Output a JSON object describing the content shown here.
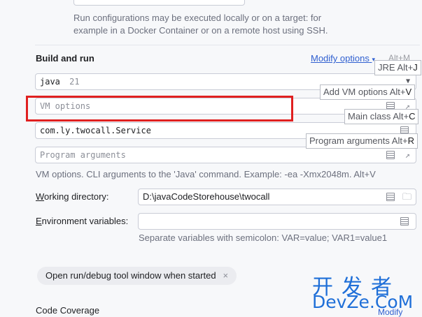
{
  "description": {
    "line1": "Run configurations may be executed locally or on a target: for",
    "line2": "example in a Docker Container or on a remote host using SSH."
  },
  "build_and_run": {
    "title": "Build and run",
    "modify_options_label": "Modify options",
    "modify_options_shortcut": "Alt+M",
    "jre": {
      "value": "java",
      "version": "21"
    },
    "vm_options": {
      "placeholder": "VM options"
    },
    "main_class": {
      "value": "com.ly.twocall.Service"
    },
    "program_arguments": {
      "placeholder": "Program arguments"
    },
    "vm_hint": "VM options. CLI arguments to the 'Java' command. Example: -ea -Xmx2048m. Alt+V"
  },
  "popups": {
    "jre": {
      "label": "JRE",
      "shortcut": "Alt+",
      "key": "J"
    },
    "vm": {
      "label": "Add VM options",
      "shortcut": "Alt+",
      "key": "V"
    },
    "main": {
      "label": "Main class",
      "shortcut": "Alt+",
      "key": "C"
    },
    "args": {
      "label": "Program arguments",
      "shortcut": "Alt+",
      "key": "R"
    }
  },
  "working_directory": {
    "label_prefix": "",
    "label_mnemonic": "W",
    "label_rest": "orking directory:",
    "value": "D:\\javaCodeStorehouse\\twocall"
  },
  "environment_variables": {
    "label_mnemonic": "E",
    "label_rest": "nvironment variables:",
    "hint": "Separate variables with semicolon: VAR=value; VAR1=value1"
  },
  "chip": {
    "label": "Open run/debug tool window when started",
    "close": "×"
  },
  "code_coverage": {
    "label": "Code Coverage",
    "modify": "Modify"
  },
  "watermark": {
    "cn": "开发者",
    "en": "DevZe.CoM"
  },
  "colors": {
    "accent": "#2f5fd0",
    "highlight_box": "#e02020",
    "watermark": "#1f6fd8"
  }
}
